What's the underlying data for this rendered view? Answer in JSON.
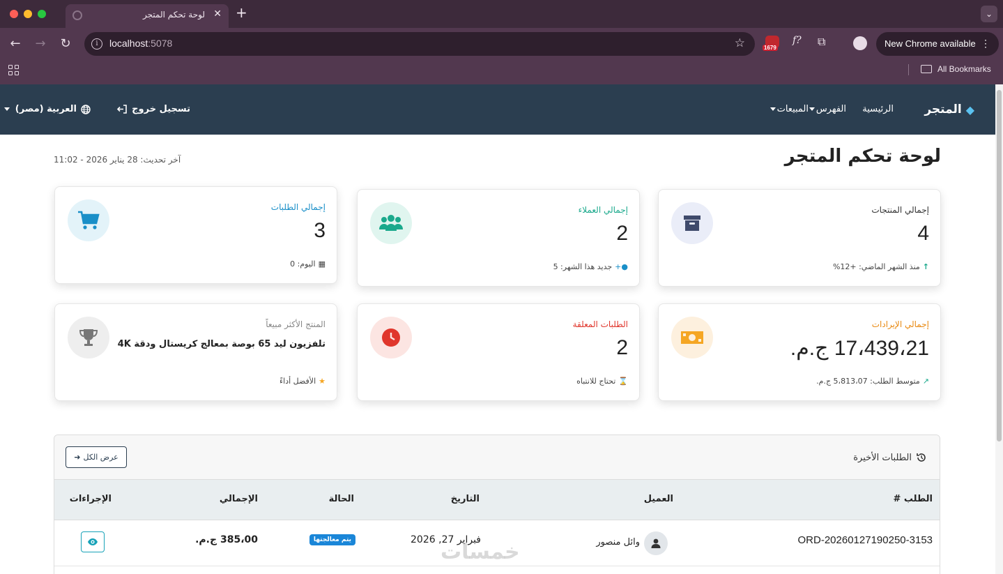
{
  "browser": {
    "tab_title": "لوحة تحكم المتجر",
    "url_host": "localhost",
    "url_port": ":5078",
    "extension_badge": "1679",
    "update_label": "New Chrome available",
    "bookmarks_label": "All Bookmarks"
  },
  "navbar": {
    "brand": "المتجر",
    "links": [
      "الرئيسية",
      "الفهرس",
      "المبيعات"
    ],
    "logout": "تسجيل خروج",
    "language": "العربية (مصر)"
  },
  "header": {
    "title": "لوحة تحكم المتجر",
    "last_update": "آخر تحديث: 28 يناير 2026 - 11:02"
  },
  "cards": [
    {
      "label": "إجمالي المنتجات",
      "value": "4",
      "foot": "منذ الشهر الماضي: +12%",
      "label_color": "#333333",
      "icon": "box-icon"
    },
    {
      "label": "إجمالي العملاء",
      "value": "2",
      "foot": "جديد هذا الشهر: 5",
      "label_color": "#1aa98c",
      "icon": "users-icon"
    },
    {
      "label": "إجمالي الطلبات",
      "value": "3",
      "foot": "اليوم: 0",
      "label_color": "#1a8fc8",
      "icon": "cart-icon"
    },
    {
      "label": "إجمالي الإيرادات",
      "value": "17،439،21 ج.م.",
      "foot": "متوسط الطلب: 5،813،07 ج.م.",
      "label_color": "#e98a12",
      "icon": "money-icon"
    },
    {
      "label": "الطلبات المعلقة",
      "value": "2",
      "foot": "تحتاج للانتباه",
      "label_color": "#e0362c",
      "icon": "clock-icon"
    },
    {
      "label": "المنتج الأكثر مبيعاً",
      "value": "تلفزيون ليد 65 بوصة بمعالج كريستال ودقة 4K",
      "foot": "الأفضل أداءً",
      "label_color": "#888888",
      "icon": "trophy-icon"
    }
  ],
  "orders": {
    "title": "الطلبات الأخيرة",
    "view_all": "عرض الكل",
    "columns": [
      "الطلب #",
      "العميل",
      "التاريخ",
      "الحالة",
      "الإجمالي",
      "الإجراءات"
    ],
    "rows": [
      {
        "id": "ORD-20260127190250-3153",
        "customer": "وائل منصور",
        "date": "فبراير 27, 2026",
        "status": "يتم معالجتها",
        "total": "385،00 ج.م."
      }
    ]
  },
  "watermark": "خمسات",
  "colors": {
    "navbar": "#2b3e50",
    "status_badge": "#1a86d8",
    "accent_teal": "#17a2b8"
  }
}
